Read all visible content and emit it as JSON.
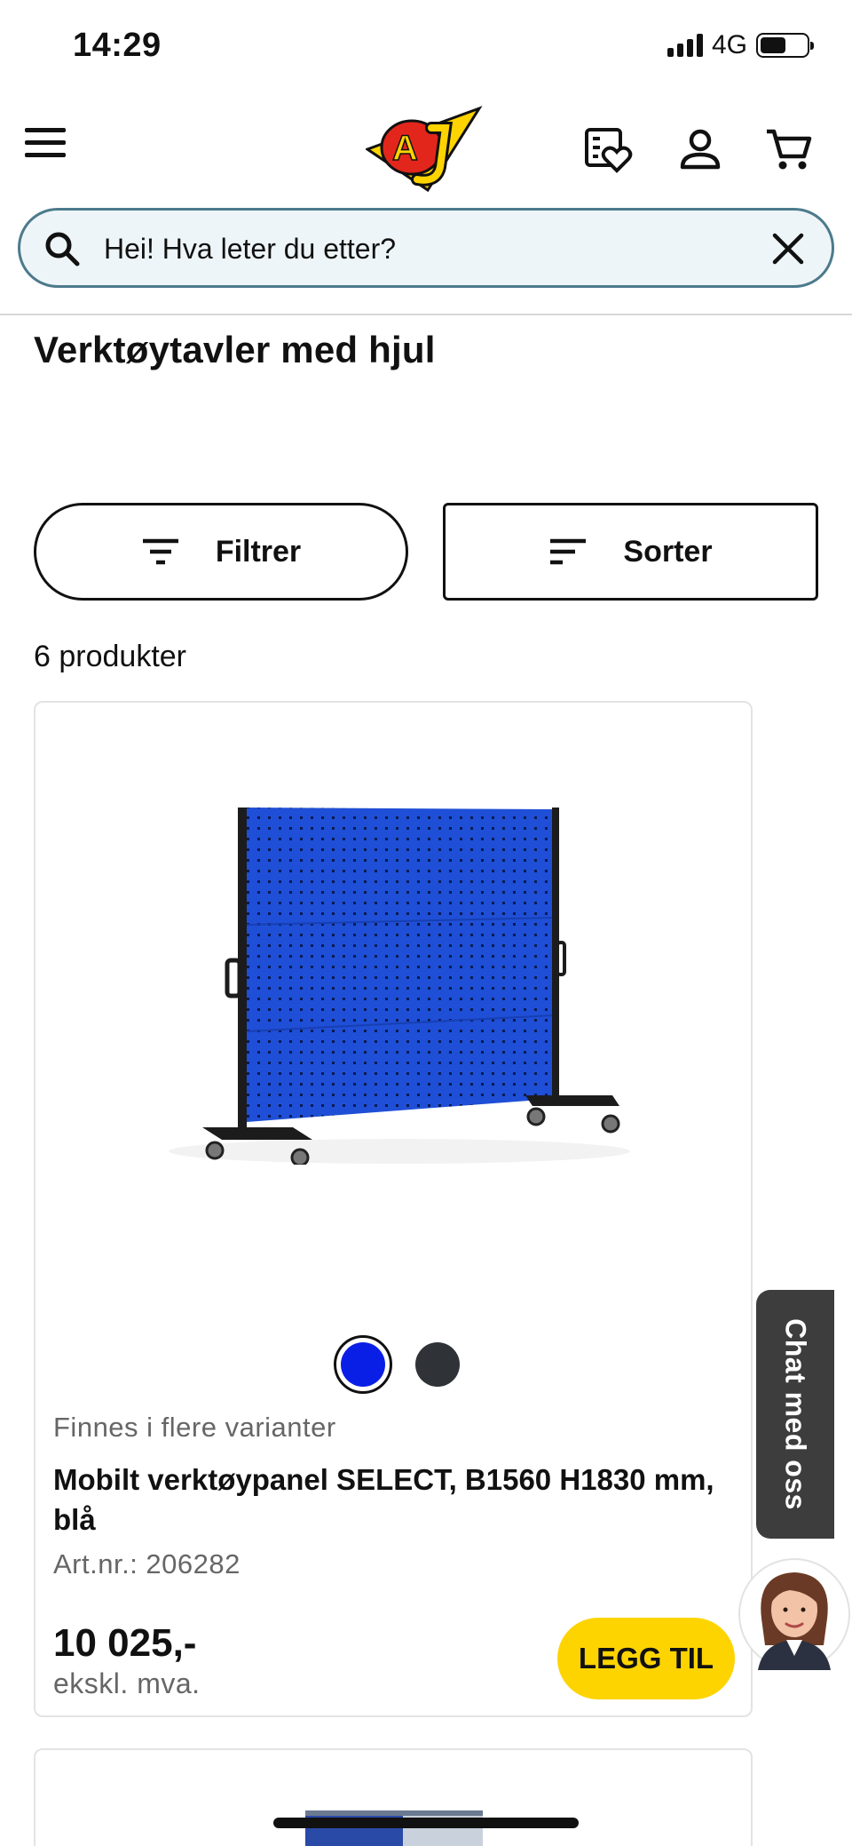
{
  "status_bar": {
    "time": "14:29",
    "network": "4G"
  },
  "header": {
    "menu_icon": "hamburger-menu-icon",
    "logo_text": "AJ",
    "icons": [
      "wishlist-icon",
      "account-icon",
      "cart-icon"
    ]
  },
  "search": {
    "placeholder": "Hei! Hva leter du etter?",
    "value": ""
  },
  "page": {
    "title": "Verktøytavler med hjul",
    "filter_label": "Filtrer",
    "sort_label": "Sorter",
    "product_count": "6 produkter"
  },
  "products": [
    {
      "variants_text": "Finnes i flere varianter",
      "name": "Mobilt verktøypanel SELECT, B1560 H1830 mm, blå",
      "art_nr": "Art.nr.: 206282",
      "price": "10 025,-",
      "vat_text": "ekskl. mva.",
      "add_label": "LEGG TIL",
      "swatches": [
        {
          "color": "#0a1fe6",
          "selected": true
        },
        {
          "color": "#2f3237",
          "selected": false
        }
      ]
    }
  ],
  "chat": {
    "label": "Chat med oss"
  },
  "colors": {
    "accent_yellow": "#fdd400",
    "search_border": "#4c7a8c",
    "search_bg": "#eef5f8",
    "chat_bg": "#3d3d3d",
    "panel_blue": "#1f4fd6"
  }
}
